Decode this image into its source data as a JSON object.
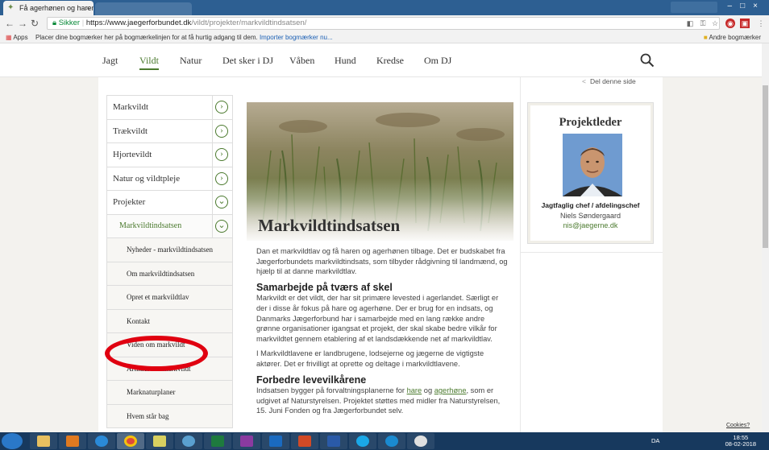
{
  "browser": {
    "tab_title": "Få agerhønen og haren tilbage",
    "secure_label": "Sikker",
    "url_host": "https://www.jaegerforbundet.dk",
    "url_path": "/vildt/projekter/markvildtindsatsen/",
    "bookmarks_apps": "Apps",
    "bookmarks_hint": "Placer dine bogmærker her på bogmærkelinjen for at få hurtig adgang til dem.",
    "bookmarks_import": "Importer bogmærker nu...",
    "bookmarks_other": "Andre bogmærker"
  },
  "nav": {
    "items": [
      "Jagt",
      "Vildt",
      "Natur",
      "Det sker i DJ",
      "Våben",
      "Hund",
      "Kredse",
      "Om DJ"
    ],
    "active": "Vildt"
  },
  "sidebar": {
    "items": [
      {
        "label": "Markvildt",
        "level": 1,
        "icon": "chevron-right"
      },
      {
        "label": "Trækvildt",
        "level": 1,
        "icon": "chevron-right"
      },
      {
        "label": "Hjortevildt",
        "level": 1,
        "icon": "chevron-right"
      },
      {
        "label": "Natur og vildtpleje",
        "level": 1,
        "icon": "chevron-right"
      },
      {
        "label": "Projekter",
        "level": 1,
        "icon": "chevron-down"
      },
      {
        "label": "Markvildtindsatsen",
        "level": 2,
        "icon": "chevron-down"
      },
      {
        "label": "Nyheder - markvildtindsatsen",
        "level": 3
      },
      {
        "label": "Om markvildtindsatsen",
        "level": 3
      },
      {
        "label": "Opret et markvildtlav",
        "level": 3
      },
      {
        "label": "Kontakt",
        "level": 3
      },
      {
        "label": "Viden om markvildt",
        "level": 3
      },
      {
        "label": "Artikler om markvildt",
        "level": 3
      },
      {
        "label": "Marknaturplaner",
        "level": 3
      },
      {
        "label": "Hvem står bag",
        "level": 3
      }
    ]
  },
  "article": {
    "title": "Markvildtindsatsen",
    "intro": "Dan et markvildtlav og få haren og agerhønen tilbage. Det er budskabet fra Jægerforbundets markvildtindsats, som tilbyder rådgivning til landmænd, og hjælp til at danne markvildtlav.",
    "h1": "Samarbejde på tværs af skel",
    "p1": "Markvildt er det vildt, der har sit primære levested i agerlandet. Særligt er der i disse år fokus på hare og agerhøne. Der er brug for en indsats, og Danmarks Jægerforbund har i samarbejde med en lang række andre grønne organisationer igangsat et projekt, der skal skabe bedre vilkår for markvildtet gennem etablering af et landsdækkende net af markvildtlav.",
    "p2": "I Markvildtlavene er landbrugene, lodsejerne og jægerne de vigtigste aktører. Det er frivilligt at oprette og deltage i markvildtlavene.",
    "h2": "Forbedre levevilkårene",
    "p3_before": "Indsatsen bygger på forvaltningsplanerne for ",
    "p3_link1": "hare",
    "p3_mid": " og ",
    "p3_link2": "agerhøne",
    "p3_after": ", som er udgivet af Naturstyrelsen. Projektet støttes med midler fra Naturstyrelsen, 15. Juni Fonden og fra Jægerforbundet selv."
  },
  "share": {
    "label": "Del denne side"
  },
  "project_leader": {
    "heading": "Projektleder",
    "role": "Jagtfaglig chef / afdelingschef",
    "name": "Niels Søndergaard",
    "email": "nis@jaegerne.dk"
  },
  "footer": {
    "cookies": "Cookies?"
  },
  "taskbar": {
    "lang": "DA",
    "time": "18:55",
    "date": "08-02-2018"
  },
  "colors": {
    "accent_green": "#4b7a2e",
    "highlight_red": "#e00010"
  }
}
